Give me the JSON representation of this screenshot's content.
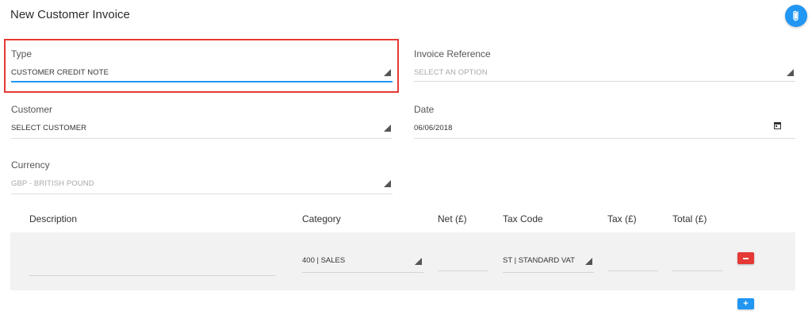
{
  "page": {
    "title": "New Customer Invoice"
  },
  "form": {
    "type": {
      "label": "Type",
      "value": "CUSTOMER CREDIT NOTE"
    },
    "invoice_reference": {
      "label": "Invoice Reference",
      "placeholder": "SELECT AN OPTION"
    },
    "customer": {
      "label": "Customer",
      "value": "SELECT CUSTOMER"
    },
    "date": {
      "label": "Date",
      "value": "06/06/2018"
    },
    "currency": {
      "label": "Currency",
      "value": "GBP - BRITISH POUND"
    }
  },
  "table": {
    "headers": {
      "description": "Description",
      "category": "Category",
      "net": "Net (£)",
      "tax_code": "Tax Code",
      "tax": "Tax (£)",
      "total": "Total (£)"
    },
    "rows": [
      {
        "description": "",
        "category": "400 | SALES",
        "net": "",
        "tax_code": "ST | STANDARD VAT",
        "tax": "",
        "total": ""
      }
    ]
  },
  "colors": {
    "accent": "#2196f3",
    "danger": "#e53935",
    "highlight_border": "#e53935"
  },
  "icons": {
    "attach": "paperclip-icon",
    "date": "calendar-icon",
    "remove": "minus-icon",
    "add": "plus-icon"
  }
}
